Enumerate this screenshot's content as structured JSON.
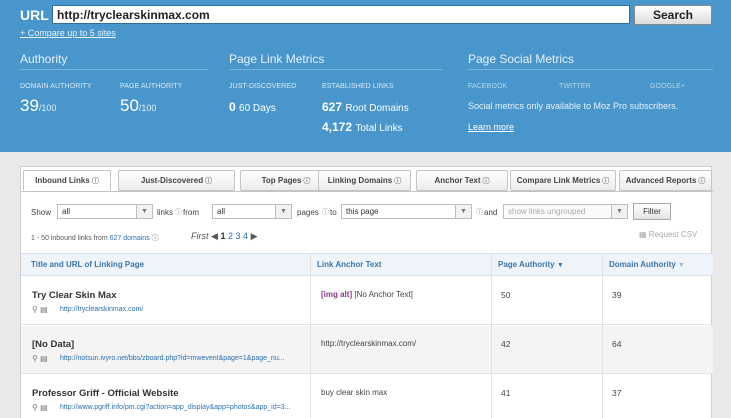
{
  "url_bar": {
    "label": "URL",
    "value": "http://tryclearskinmax.com",
    "search_label": "Search"
  },
  "compare_link": "+ Compare up to 5 sites",
  "authority": {
    "title": "Authority",
    "domain_label": "DOMAIN AUTHORITY",
    "domain_value": "39",
    "domain_suffix": "/100",
    "page_label": "PAGE AUTHORITY",
    "page_value": "50",
    "page_suffix": "/100"
  },
  "link_metrics": {
    "title": "Page Link Metrics",
    "just_label": "JUST-DISCOVERED",
    "just_value": "0",
    "just_unit": "60 Days",
    "est_label": "ESTABLISHED LINKS",
    "root_value": "627",
    "root_unit": "Root Domains",
    "total_value": "4,172",
    "total_unit": "Total Links"
  },
  "social": {
    "title": "Page Social Metrics",
    "facebook": "FACEBOOK",
    "twitter": "TWITTER",
    "google": "GOOGLE+",
    "message": "Social metrics only available to Moz Pro subscribers.",
    "learn_more": "Learn more"
  },
  "tabs": [
    {
      "label": "Inbound Links",
      "active": true
    },
    {
      "label": "Just-Discovered"
    },
    {
      "label": "Top Pages"
    },
    {
      "label": "Linking Domains"
    },
    {
      "label": "Anchor Text"
    },
    {
      "label": "Compare Link Metrics"
    },
    {
      "label": "Advanced Reports"
    }
  ],
  "filters": {
    "show": "Show",
    "links_from": "links",
    "from": "from",
    "pages_to": "pages",
    "to": "to",
    "and": "and",
    "sel1": "all",
    "sel2": "all",
    "sel3": "this page",
    "sel4": "show links ungrouped",
    "filter_btn": "Filter"
  },
  "results": {
    "prefix": "1 - 50 inbound links from",
    "domains": "627 domains",
    "first": "First",
    "pages": [
      "1",
      "2",
      "3",
      "4"
    ],
    "request_csv": "Request CSV"
  },
  "columns": {
    "title_url": "Title and URL of Linking Page",
    "anchor": "Link Anchor Text",
    "pa": "Page Authority",
    "da": "Domain Authority"
  },
  "rows": [
    {
      "title": "Try Clear Skin Max",
      "url": "http://tryclearskinmax.com/",
      "anchor_tag": "[img alt]",
      "anchor": "[No Anchor Text]",
      "pa": "50",
      "da": "39"
    },
    {
      "title": "[No Data]",
      "url": "http://notsun.ivyro.net/bbs/zboard.php?id=mwevent&page=1&page_nu...",
      "anchor_tag": "",
      "anchor": "http://tryclearskinmax.com/",
      "pa": "42",
      "da": "64"
    },
    {
      "title": "Professor Griff - Official Website",
      "url": "http://www.pgriff.info/pm.cgi?action=app_display&app=photos&app_id=3...",
      "anchor_tag": "",
      "anchor": "buy clear skin max",
      "pa": "41",
      "da": "37"
    }
  ],
  "colors": {
    "header_blue": "#4896cc",
    "link_blue": "#2a6fb0",
    "img_alt_purple": "#8a3a8a"
  }
}
